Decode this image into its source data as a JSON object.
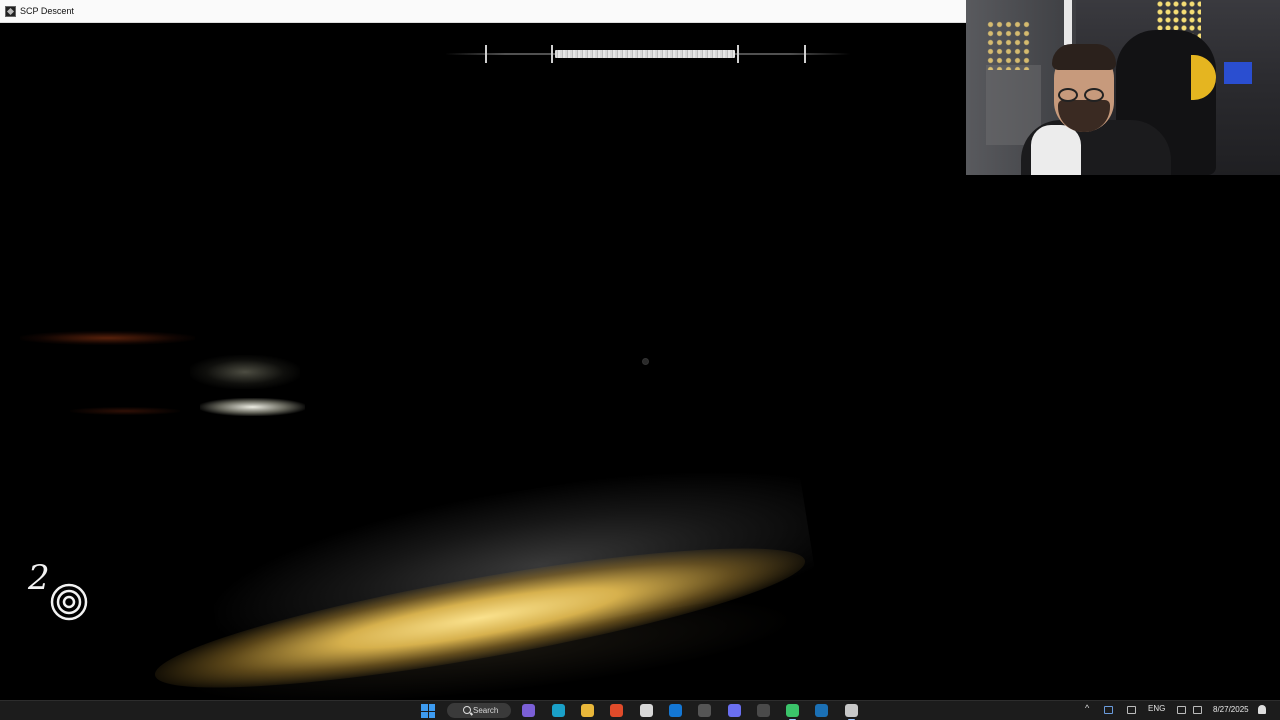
{
  "window": {
    "title": "SCP Descent",
    "icon": "scp-descent-app-icon"
  },
  "hud": {
    "crosshair": "dot",
    "item_count": "2",
    "item_icon": "spiral-icon",
    "top_meter": "compass-stamina-bar"
  },
  "webcam": {
    "description_icon": "streamer-webcam"
  },
  "taskbar": {
    "search_label": "Search",
    "apps": [
      "start-icon",
      "search-icon",
      "teams-icon",
      "edge-icon",
      "file-explorer-icon",
      "brave-icon",
      "app-grid-icon",
      "outlook-icon",
      "game-icon",
      "discord-icon",
      "terminal-icon",
      "android-icon",
      "steam-icon",
      "notepad-icon"
    ],
    "language": "ENG",
    "date": "8/27/2025"
  },
  "colors": {
    "accent_blue": "#3d9bf0",
    "floor_light": "#e1bb55",
    "background": "#000000"
  }
}
